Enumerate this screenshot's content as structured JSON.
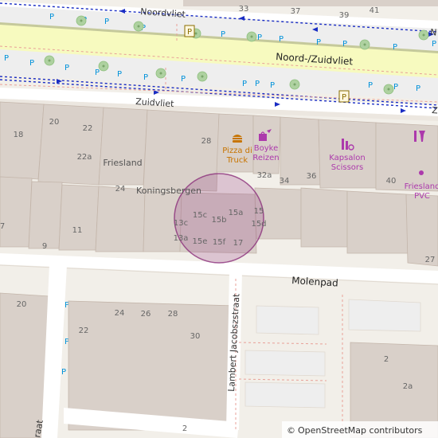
{
  "streets": {
    "noordvliet": "Noordvliet",
    "noord_zuidvliet": "Noord-/Zuidvliet",
    "zuidvliet": "Zuidvliet",
    "molenpad": "Molenpad",
    "lambert": "Lambert Jacobszstraat",
    "edge_n": "N",
    "edge_z": "Z",
    "edge_straat": "raat"
  },
  "places": {
    "friesland": "Friesland",
    "koningsbergen": "Koningsbergen",
    "pizza_line1": "Pizza di",
    "pizza_line2": "Truck",
    "boyke_line1": "Boyke",
    "boyke_line2": "Reizen",
    "kapsalon_line1": "Kapsalon",
    "kapsalon_line2": "Scissors",
    "pvc_line1": "Friesland",
    "pvc_line2": "PVC"
  },
  "house_numbers": {
    "n33": "33",
    "n37": "37",
    "n39": "39",
    "n41": "41",
    "n20": "20",
    "n22": "22",
    "n18": "18",
    "n22a": "22a",
    "n24": "24",
    "n28": "28",
    "n32a": "32a",
    "n34": "34",
    "n36": "36",
    "n40": "40",
    "n15c": "15c",
    "n15b": "15b",
    "n15a": "15a",
    "n15": "15",
    "n15d": "15d",
    "n13c": "13c",
    "n13a": "13a",
    "n15e": "15e",
    "n15f": "15f",
    "n17": "17",
    "n11": "11",
    "n9": "9",
    "n7": "7",
    "n27": "27",
    "s20": "20",
    "s22": "22",
    "s24": "24",
    "s26": "26",
    "s28": "28",
    "s30": "30",
    "s2a": "2",
    "s2b": "2a",
    "s2c": "2"
  },
  "parking_symbol": "P",
  "attribution": {
    "symbol": "©",
    "text": "OpenStreetMap contributors"
  },
  "colors": {
    "background": "#f2efe9",
    "building": "#d9d0c9",
    "building_stroke": "#c4b6ab",
    "road": "#ffffff",
    "primary_road": "#f7fabf",
    "primary_road_casing": "#c5c99b",
    "parking": "#eeeeee",
    "tree": "#aed1a0",
    "bus_route": "#1a2dc4",
    "highlight_fill": "#8b2f7a",
    "poi_amenity": "#c77400",
    "poi_shop": "#ac39ac",
    "parking_text": "#0092da",
    "house_number": "#666666",
    "label": "#333333"
  }
}
